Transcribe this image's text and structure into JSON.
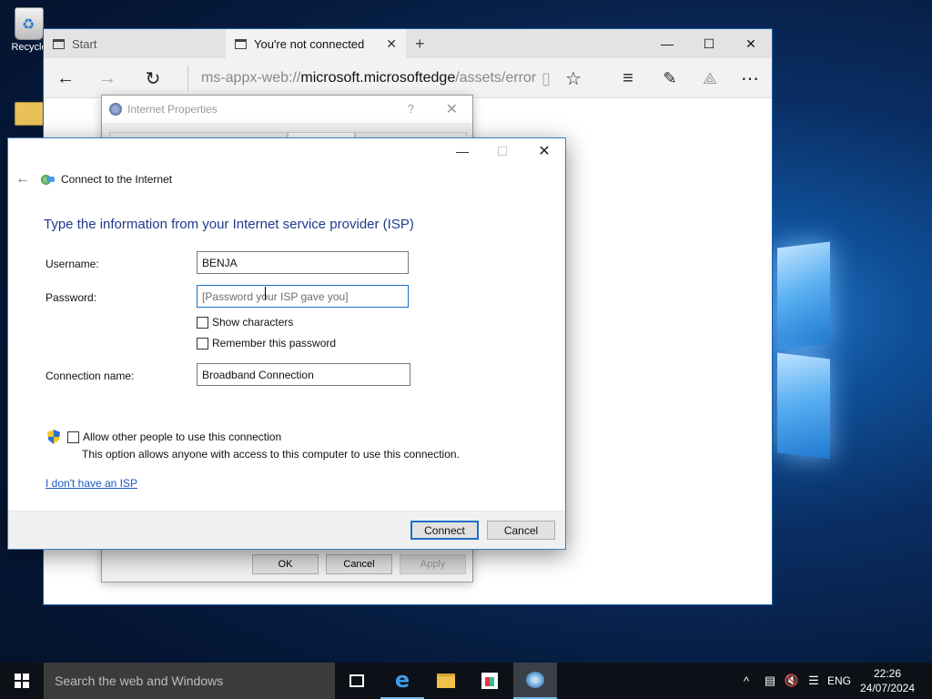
{
  "desktop": {
    "recycle_label": "Recycle"
  },
  "edge": {
    "tabs": [
      {
        "label": "Start"
      },
      {
        "label": "You're not connected"
      }
    ],
    "address": {
      "scheme": "ms-appx-web://",
      "host": "microsoft.microsoftedge",
      "path": "/assets/error"
    }
  },
  "internet_properties": {
    "title": "Internet Properties",
    "help_glyph": "?",
    "buttons": {
      "ok": "OK",
      "cancel": "Cancel",
      "apply": "Apply"
    }
  },
  "connect_dialog": {
    "nav_title": "Connect to the Internet",
    "heading": "Type the information from your Internet service provider (ISP)",
    "username_label": "Username:",
    "username_value": "BENJA",
    "password_label": "Password:",
    "password_placeholder": "[Password your ISP gave you]",
    "show_characters": "Show characters",
    "remember_password": "Remember this password",
    "connection_name_label": "Connection name:",
    "connection_name_value": "Broadband Connection",
    "allow_others": "Allow other people to use this connection",
    "allow_others_help": "This option allows anyone with access to this computer to use this connection.",
    "no_isp_link": "I don't have an ISP",
    "connect_button": "Connect",
    "cancel_button": "Cancel"
  },
  "taskbar": {
    "search_placeholder": "Search the web and Windows",
    "language": "ENG",
    "time": "22:26",
    "date": "24/07/2024"
  },
  "colors": {
    "accent": "#1f6fc5",
    "link": "#1a57c6",
    "heading": "#1e3a8a",
    "taskbar": "#0d1117"
  }
}
